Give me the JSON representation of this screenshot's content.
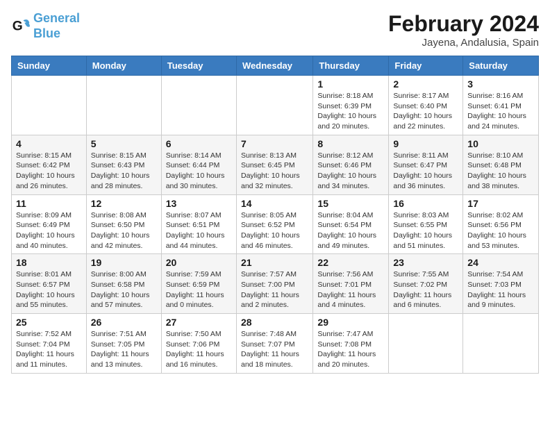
{
  "header": {
    "logo_general": "General",
    "logo_blue": "Blue",
    "month_year": "February 2024",
    "location": "Jayena, Andalusia, Spain"
  },
  "days_of_week": [
    "Sunday",
    "Monday",
    "Tuesday",
    "Wednesday",
    "Thursday",
    "Friday",
    "Saturday"
  ],
  "weeks": [
    [
      {
        "num": "",
        "info": ""
      },
      {
        "num": "",
        "info": ""
      },
      {
        "num": "",
        "info": ""
      },
      {
        "num": "",
        "info": ""
      },
      {
        "num": "1",
        "info": "Sunrise: 8:18 AM\nSunset: 6:39 PM\nDaylight: 10 hours\nand 20 minutes."
      },
      {
        "num": "2",
        "info": "Sunrise: 8:17 AM\nSunset: 6:40 PM\nDaylight: 10 hours\nand 22 minutes."
      },
      {
        "num": "3",
        "info": "Sunrise: 8:16 AM\nSunset: 6:41 PM\nDaylight: 10 hours\nand 24 minutes."
      }
    ],
    [
      {
        "num": "4",
        "info": "Sunrise: 8:15 AM\nSunset: 6:42 PM\nDaylight: 10 hours\nand 26 minutes."
      },
      {
        "num": "5",
        "info": "Sunrise: 8:15 AM\nSunset: 6:43 PM\nDaylight: 10 hours\nand 28 minutes."
      },
      {
        "num": "6",
        "info": "Sunrise: 8:14 AM\nSunset: 6:44 PM\nDaylight: 10 hours\nand 30 minutes."
      },
      {
        "num": "7",
        "info": "Sunrise: 8:13 AM\nSunset: 6:45 PM\nDaylight: 10 hours\nand 32 minutes."
      },
      {
        "num": "8",
        "info": "Sunrise: 8:12 AM\nSunset: 6:46 PM\nDaylight: 10 hours\nand 34 minutes."
      },
      {
        "num": "9",
        "info": "Sunrise: 8:11 AM\nSunset: 6:47 PM\nDaylight: 10 hours\nand 36 minutes."
      },
      {
        "num": "10",
        "info": "Sunrise: 8:10 AM\nSunset: 6:48 PM\nDaylight: 10 hours\nand 38 minutes."
      }
    ],
    [
      {
        "num": "11",
        "info": "Sunrise: 8:09 AM\nSunset: 6:49 PM\nDaylight: 10 hours\nand 40 minutes."
      },
      {
        "num": "12",
        "info": "Sunrise: 8:08 AM\nSunset: 6:50 PM\nDaylight: 10 hours\nand 42 minutes."
      },
      {
        "num": "13",
        "info": "Sunrise: 8:07 AM\nSunset: 6:51 PM\nDaylight: 10 hours\nand 44 minutes."
      },
      {
        "num": "14",
        "info": "Sunrise: 8:05 AM\nSunset: 6:52 PM\nDaylight: 10 hours\nand 46 minutes."
      },
      {
        "num": "15",
        "info": "Sunrise: 8:04 AM\nSunset: 6:54 PM\nDaylight: 10 hours\nand 49 minutes."
      },
      {
        "num": "16",
        "info": "Sunrise: 8:03 AM\nSunset: 6:55 PM\nDaylight: 10 hours\nand 51 minutes."
      },
      {
        "num": "17",
        "info": "Sunrise: 8:02 AM\nSunset: 6:56 PM\nDaylight: 10 hours\nand 53 minutes."
      }
    ],
    [
      {
        "num": "18",
        "info": "Sunrise: 8:01 AM\nSunset: 6:57 PM\nDaylight: 10 hours\nand 55 minutes."
      },
      {
        "num": "19",
        "info": "Sunrise: 8:00 AM\nSunset: 6:58 PM\nDaylight: 10 hours\nand 57 minutes."
      },
      {
        "num": "20",
        "info": "Sunrise: 7:59 AM\nSunset: 6:59 PM\nDaylight: 11 hours\nand 0 minutes."
      },
      {
        "num": "21",
        "info": "Sunrise: 7:57 AM\nSunset: 7:00 PM\nDaylight: 11 hours\nand 2 minutes."
      },
      {
        "num": "22",
        "info": "Sunrise: 7:56 AM\nSunset: 7:01 PM\nDaylight: 11 hours\nand 4 minutes."
      },
      {
        "num": "23",
        "info": "Sunrise: 7:55 AM\nSunset: 7:02 PM\nDaylight: 11 hours\nand 6 minutes."
      },
      {
        "num": "24",
        "info": "Sunrise: 7:54 AM\nSunset: 7:03 PM\nDaylight: 11 hours\nand 9 minutes."
      }
    ],
    [
      {
        "num": "25",
        "info": "Sunrise: 7:52 AM\nSunset: 7:04 PM\nDaylight: 11 hours\nand 11 minutes."
      },
      {
        "num": "26",
        "info": "Sunrise: 7:51 AM\nSunset: 7:05 PM\nDaylight: 11 hours\nand 13 minutes."
      },
      {
        "num": "27",
        "info": "Sunrise: 7:50 AM\nSunset: 7:06 PM\nDaylight: 11 hours\nand 16 minutes."
      },
      {
        "num": "28",
        "info": "Sunrise: 7:48 AM\nSunset: 7:07 PM\nDaylight: 11 hours\nand 18 minutes."
      },
      {
        "num": "29",
        "info": "Sunrise: 7:47 AM\nSunset: 7:08 PM\nDaylight: 11 hours\nand 20 minutes."
      },
      {
        "num": "",
        "info": ""
      },
      {
        "num": "",
        "info": ""
      }
    ]
  ]
}
